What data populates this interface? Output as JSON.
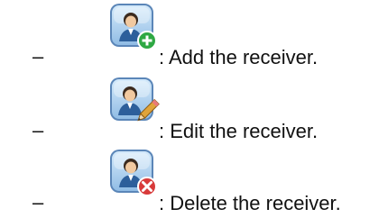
{
  "items": [
    {
      "bullet": "–",
      "icon": "add-user-icon",
      "text": ": Add the receiver."
    },
    {
      "bullet": "–",
      "icon": "edit-user-icon",
      "text": ": Edit the receiver."
    },
    {
      "bullet": "–",
      "icon": "delete-user-icon",
      "text": ": Delete the receiver."
    }
  ],
  "colors": {
    "icon_frame": "#5b86b8",
    "icon_bg": "#a9cdee",
    "add_badge": "#2ea843",
    "delete_badge": "#d83a3a",
    "pencil": "#e0a43a"
  }
}
